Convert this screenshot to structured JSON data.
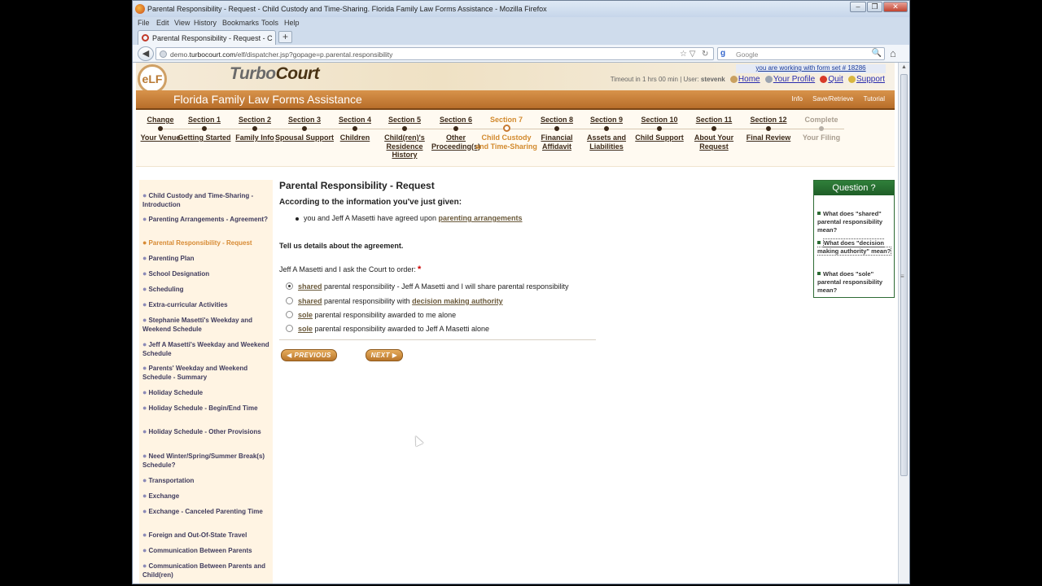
{
  "window": {
    "title": "Parental Responsibility - Request - Child Custody and Time-Sharing. Florida Family Law Forms Assistance - Mozilla Firefox",
    "min_glyph": "–",
    "max_glyph": "❐",
    "close_glyph": "✕"
  },
  "menubar": [
    "File",
    "Edit",
    "View",
    "History",
    "Bookmarks",
    "Tools",
    "Help"
  ],
  "tab": {
    "label": "Parental Responsibility - Request - Child ...",
    "new_tab_glyph": "+"
  },
  "navbar": {
    "back_glyph": "◀",
    "url_prefix": "demo.",
    "url_domain": "turbocourt.com",
    "url_path": "/elf/dispatcher.jsp?gopage=p.parental.responsibility",
    "star_glyph": "☆ ▽",
    "reload_glyph": "↻",
    "search_placeholder": "Google",
    "search_logo": "g",
    "search_glyph": "🔍",
    "home_glyph": "⌂"
  },
  "site": {
    "logo_text": "eLF",
    "brand_turbo": "Turbo",
    "brand_court": "Court",
    "form_set": "you are working with form set # 18286",
    "timeout": "Timeout in 1 hrs 00 min",
    "user_label": "User:",
    "user_name": "stevenk",
    "links": {
      "home": "Home",
      "profile": "Your Profile",
      "quit": "Quit",
      "support": "Support"
    },
    "banner_title": "Florida Family Law Forms Assistance",
    "banner_actions": {
      "info": "Info",
      "save": "Save/Retrieve",
      "tutorial": "Tutorial"
    }
  },
  "sections": [
    {
      "head": "Change",
      "label": "Your Venue"
    },
    {
      "head": "Section 1",
      "label": "Getting Started"
    },
    {
      "head": "Section 2",
      "label": "Family Info"
    },
    {
      "head": "Section 3",
      "label": "Spousal Support"
    },
    {
      "head": "Section 4",
      "label": "Children"
    },
    {
      "head": "Section 5",
      "label": "Child(ren)'s Residence History"
    },
    {
      "head": "Section 6",
      "label": "Other Proceeding(s)"
    },
    {
      "head": "Section 7",
      "label": "Child Custody and Time-Sharing"
    },
    {
      "head": "Section 8",
      "label": "Financial Affidavit"
    },
    {
      "head": "Section 9",
      "label": "Assets and Liabilities"
    },
    {
      "head": "Section 10",
      "label": "Child Support"
    },
    {
      "head": "Section 11",
      "label": "About Your Request"
    },
    {
      "head": "Section 12",
      "label": "Final Review"
    },
    {
      "head": "Complete",
      "label": "Your Filing"
    }
  ],
  "sidebar": [
    "Child Custody and Time-Sharing - Introduction",
    "Parenting Arrangements - Agreement?",
    "Parental Responsibility - Request",
    "Parenting Plan",
    "School Designation",
    "Scheduling",
    "Extra-curricular Activities",
    "Stephanie Masetti's Weekday and Weekend Schedule",
    "Jeff A Masetti's Weekday and Weekend Schedule",
    "Parents' Weekday and Weekend Schedule - Summary",
    "Holiday Schedule",
    "Holiday Schedule - Begin/End Time",
    "Holiday Schedule - Other Provisions",
    "Need Winter/Spring/Summer Break(s) Schedule?",
    "Transportation",
    "Exchange",
    "Exchange - Canceled Parenting Time",
    "Foreign and Out-Of-State Travel",
    "Communication Between Parents",
    "Communication Between Parents and Child(ren)"
  ],
  "content": {
    "title": "Parental Responsibility - Request",
    "intro": "According to the information you've just given:",
    "bullet_text": "you and Jeff A Masetti have agreed upon",
    "bullet_link": "parenting arrangements",
    "details": "Tell us details about the agreement.",
    "ask": "Jeff A Masetti and I ask the Court to order:",
    "required_mark": "*",
    "options": [
      {
        "link": "shared",
        "text": "parental responsibility - Jeff A Masetti and I will share parental responsibility",
        "link2": "",
        "selected": true
      },
      {
        "link": "shared",
        "text": "parental responsibility with",
        "link2": "decision making authority",
        "selected": false
      },
      {
        "link": "sole",
        "text": "parental responsibility awarded to me alone",
        "link2": "",
        "selected": false
      },
      {
        "link": "sole",
        "text": "parental responsibility awarded to Jeff A Masetti alone",
        "link2": "",
        "selected": false
      }
    ],
    "prev_label": "◀ PREVIOUS",
    "next_label": "NEXT ▶"
  },
  "question": {
    "title": "Question ?",
    "items": [
      "What does \"shared\" parental responsibility mean?",
      "What does \"decision making authority\" mean?",
      "What does \"sole\" parental responsibility mean?"
    ]
  }
}
